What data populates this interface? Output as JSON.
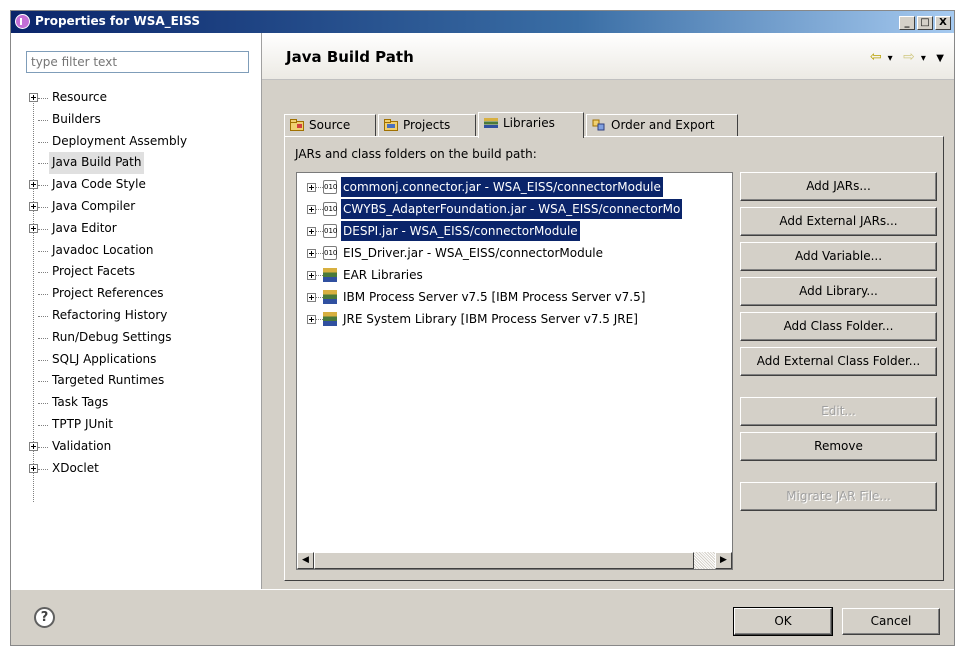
{
  "window": {
    "title": "Properties for WSA_EISS",
    "controls": [
      "_",
      "□",
      "X"
    ]
  },
  "sidebar": {
    "filter_placeholder": "type filter text",
    "items": [
      {
        "label": "Resource",
        "expandable": true
      },
      {
        "label": "Builders",
        "expandable": false
      },
      {
        "label": "Deployment Assembly",
        "expandable": false
      },
      {
        "label": "Java Build Path",
        "expandable": false,
        "selected": true
      },
      {
        "label": "Java Code Style",
        "expandable": true
      },
      {
        "label": "Java Compiler",
        "expandable": true
      },
      {
        "label": "Java Editor",
        "expandable": true
      },
      {
        "label": "Javadoc Location",
        "expandable": false
      },
      {
        "label": "Project Facets",
        "expandable": false
      },
      {
        "label": "Project References",
        "expandable": false
      },
      {
        "label": "Refactoring History",
        "expandable": false
      },
      {
        "label": "Run/Debug Settings",
        "expandable": false
      },
      {
        "label": "SQLJ Applications",
        "expandable": false
      },
      {
        "label": "Targeted Runtimes",
        "expandable": false
      },
      {
        "label": "Task Tags",
        "expandable": false
      },
      {
        "label": "TPTP JUnit",
        "expandable": false
      },
      {
        "label": "Validation",
        "expandable": true
      },
      {
        "label": "XDoclet",
        "expandable": true
      }
    ]
  },
  "header": {
    "title": "Java Build Path"
  },
  "tabs": [
    {
      "label": "Source",
      "icon": "source-folder-icon"
    },
    {
      "label": "Projects",
      "icon": "projects-folder-icon"
    },
    {
      "label": "Libraries",
      "icon": "libraries-icon",
      "active": true
    },
    {
      "label": "Order and Export",
      "icon": "order-export-icon"
    }
  ],
  "libraries": {
    "label": "JARs and class folders on the build path:",
    "entries": [
      {
        "label": "commonj.connector.jar - WSA_EISS/connectorModule",
        "type": "jar",
        "selected": true
      },
      {
        "label": "CWYBS_AdapterFoundation.jar - WSA_EISS/connectorMo",
        "type": "jar",
        "selected": true
      },
      {
        "label": "DESPI.jar - WSA_EISS/connectorModule",
        "type": "jar",
        "selected": true
      },
      {
        "label": "EIS_Driver.jar - WSA_EISS/connectorModule",
        "type": "jar",
        "selected": false
      },
      {
        "label": "EAR Libraries",
        "type": "library",
        "selected": false
      },
      {
        "label": "IBM Process Server v7.5 [IBM Process Server v7.5]",
        "type": "library",
        "selected": false
      },
      {
        "label": "JRE System Library [IBM Process Server v7.5 JRE]",
        "type": "library",
        "selected": false
      }
    ],
    "buttons": [
      {
        "label": "Add JARs...",
        "enabled": true
      },
      {
        "label": "Add External JARs...",
        "enabled": true
      },
      {
        "label": "Add Variable...",
        "enabled": true
      },
      {
        "label": "Add Library...",
        "enabled": true
      },
      {
        "label": "Add Class Folder...",
        "enabled": true
      },
      {
        "label": "Add External Class Folder...",
        "enabled": true
      },
      {
        "label": "Edit...",
        "enabled": false
      },
      {
        "label": "Remove",
        "enabled": true
      },
      {
        "label": "Migrate JAR File...",
        "enabled": false
      }
    ]
  },
  "footer": {
    "help": "?",
    "ok_label": "OK",
    "cancel_label": "Cancel"
  }
}
